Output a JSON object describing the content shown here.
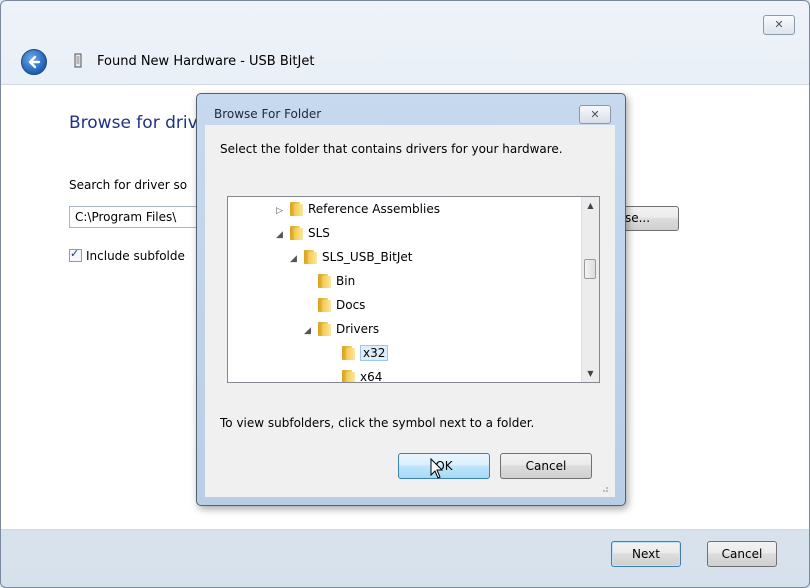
{
  "window": {
    "title": "Found New Hardware - USB BitJet",
    "close_label": "✕"
  },
  "wizard": {
    "heading": "Browse for driv",
    "search_label": "Search for driver so",
    "path_value": "C:\\Program Files\\",
    "browse_button": "se...",
    "include_subfolders_label": "Include subfolde",
    "include_subfolders_checked": true
  },
  "footer": {
    "next_label": "Next",
    "cancel_label": "Cancel"
  },
  "dialog": {
    "title": "Browse For Folder",
    "close_label": "✕",
    "instruction": "Select the folder that contains drivers for your hardware.",
    "tree": [
      {
        "label": "Reference Assemblies",
        "toggle": "▷",
        "indent": 0,
        "selected": false
      },
      {
        "label": "SLS",
        "toggle": "◢",
        "indent": 0,
        "selected": false
      },
      {
        "label": "SLS_USB_BitJet",
        "toggle": "◢",
        "indent": 1,
        "selected": false
      },
      {
        "label": "Bin",
        "toggle": "",
        "indent": 2,
        "selected": false
      },
      {
        "label": "Docs",
        "toggle": "",
        "indent": 2,
        "selected": false
      },
      {
        "label": "Drivers",
        "toggle": "◢",
        "indent": 2,
        "selected": false
      },
      {
        "label": "x32",
        "toggle": "",
        "indent": 3,
        "selected": true
      },
      {
        "label": "x64",
        "toggle": "",
        "indent": 3,
        "selected": false
      }
    ],
    "hint": "To view subfolders, click the symbol next to a folder.",
    "ok_label": "OK",
    "cancel_label": "Cancel"
  }
}
